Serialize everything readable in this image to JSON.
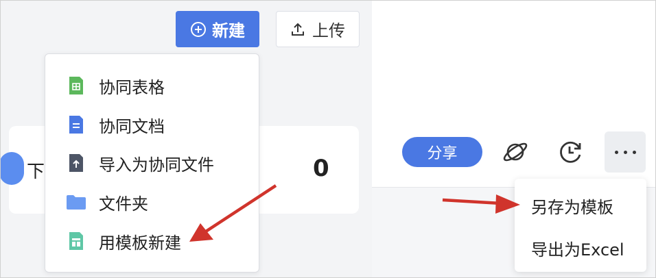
{
  "toolbar": {
    "new_label": "新建",
    "upload_label": "上传"
  },
  "card": {
    "text": "下",
    "count": "0"
  },
  "new_menu": {
    "items": [
      {
        "label": "协同表格",
        "icon": "spreadsheet-icon"
      },
      {
        "label": "协同文档",
        "icon": "document-icon"
      },
      {
        "label": "导入为协同文件",
        "icon": "import-file-icon"
      },
      {
        "label": "文件夹",
        "icon": "folder-icon"
      },
      {
        "label": "用模板新建",
        "icon": "template-icon"
      }
    ]
  },
  "right_toolbar": {
    "share_label": "分享",
    "icons": [
      "planet-icon",
      "history-icon",
      "more-icon"
    ]
  },
  "more_menu": {
    "items": [
      {
        "label": "另存为模板"
      },
      {
        "label": "导出为Excel"
      }
    ]
  },
  "colors": {
    "accent": "#4a78e3",
    "arrow": "#d0342c"
  }
}
